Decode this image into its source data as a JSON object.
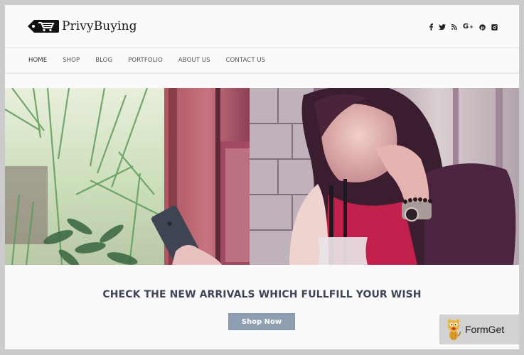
{
  "brand": {
    "name": "PrivyBuying",
    "logo_icon": "price-tag-cart-icon"
  },
  "social": [
    {
      "name": "facebook",
      "glyph": "f",
      "icon": "facebook-icon"
    },
    {
      "name": "twitter",
      "glyph": "twitter-bird",
      "icon": "twitter-icon"
    },
    {
      "name": "rss",
      "glyph": "rss",
      "icon": "rss-icon"
    },
    {
      "name": "google-plus",
      "glyph": "G+",
      "icon": "google-plus-icon"
    },
    {
      "name": "pinterest",
      "glyph": "P",
      "icon": "pinterest-icon"
    },
    {
      "name": "instagram",
      "glyph": "camera",
      "icon": "instagram-icon"
    }
  ],
  "nav": {
    "items": [
      {
        "label": "HOME",
        "active": true
      },
      {
        "label": "SHOP",
        "active": false
      },
      {
        "label": "BLOG",
        "active": false
      },
      {
        "label": "PORTFOLIO",
        "active": false
      },
      {
        "label": "ABOUT US",
        "active": false
      },
      {
        "label": "CONTACT US",
        "active": false
      }
    ]
  },
  "hero": {
    "alt": "Woman in red top looking at smartphone beside a drink, plants and red wooden door in background"
  },
  "cta": {
    "heading": "CHECK THE NEW ARRIVALS WHICH FULLFILL YOUR WISH",
    "button_label": "Shop Now"
  },
  "watermark": {
    "label": "FormGet",
    "icon": "tiger-mascot-icon"
  },
  "colors": {
    "frame_border": "#cbcbcb",
    "page_bg": "#fafafa",
    "button_bg": "#8f9fb1",
    "heading_text": "#3f4656",
    "nav_text": "#555555"
  }
}
